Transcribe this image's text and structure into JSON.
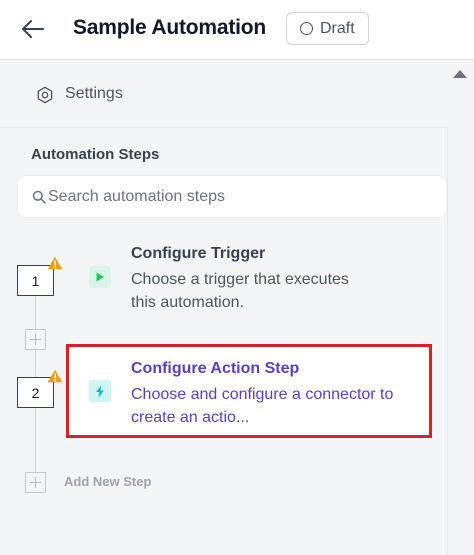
{
  "header": {
    "title": "Sample Automation",
    "status_label": "Draft"
  },
  "settings": {
    "label": "Settings"
  },
  "steps_section": {
    "title": "Automation Steps",
    "search_placeholder": "Search automation steps"
  },
  "steps": [
    {
      "number": "1",
      "title": "Configure Trigger",
      "description": "Choose a trigger that executes this automation.",
      "icon": "play-icon",
      "warning": true
    },
    {
      "number": "2",
      "title": "Configure Action Step",
      "description": "Choose and configure a connector to create an actio...",
      "icon": "lightning-icon",
      "warning": true,
      "highlighted": true
    }
  ],
  "add_step": {
    "label": "Add New Step"
  },
  "colors": {
    "accent_purple": "#5b3fc1",
    "highlight_red": "#dc1f26",
    "warning_orange": "#f59e0b",
    "trigger_green": "#22c55e",
    "action_cyan": "#06b6d4"
  }
}
